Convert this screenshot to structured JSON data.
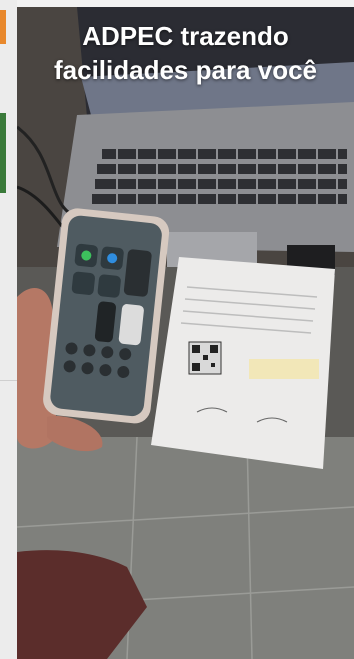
{
  "photo": {
    "caption_line1": "ADPEC trazendo",
    "caption_line2": "facilidades para você"
  }
}
